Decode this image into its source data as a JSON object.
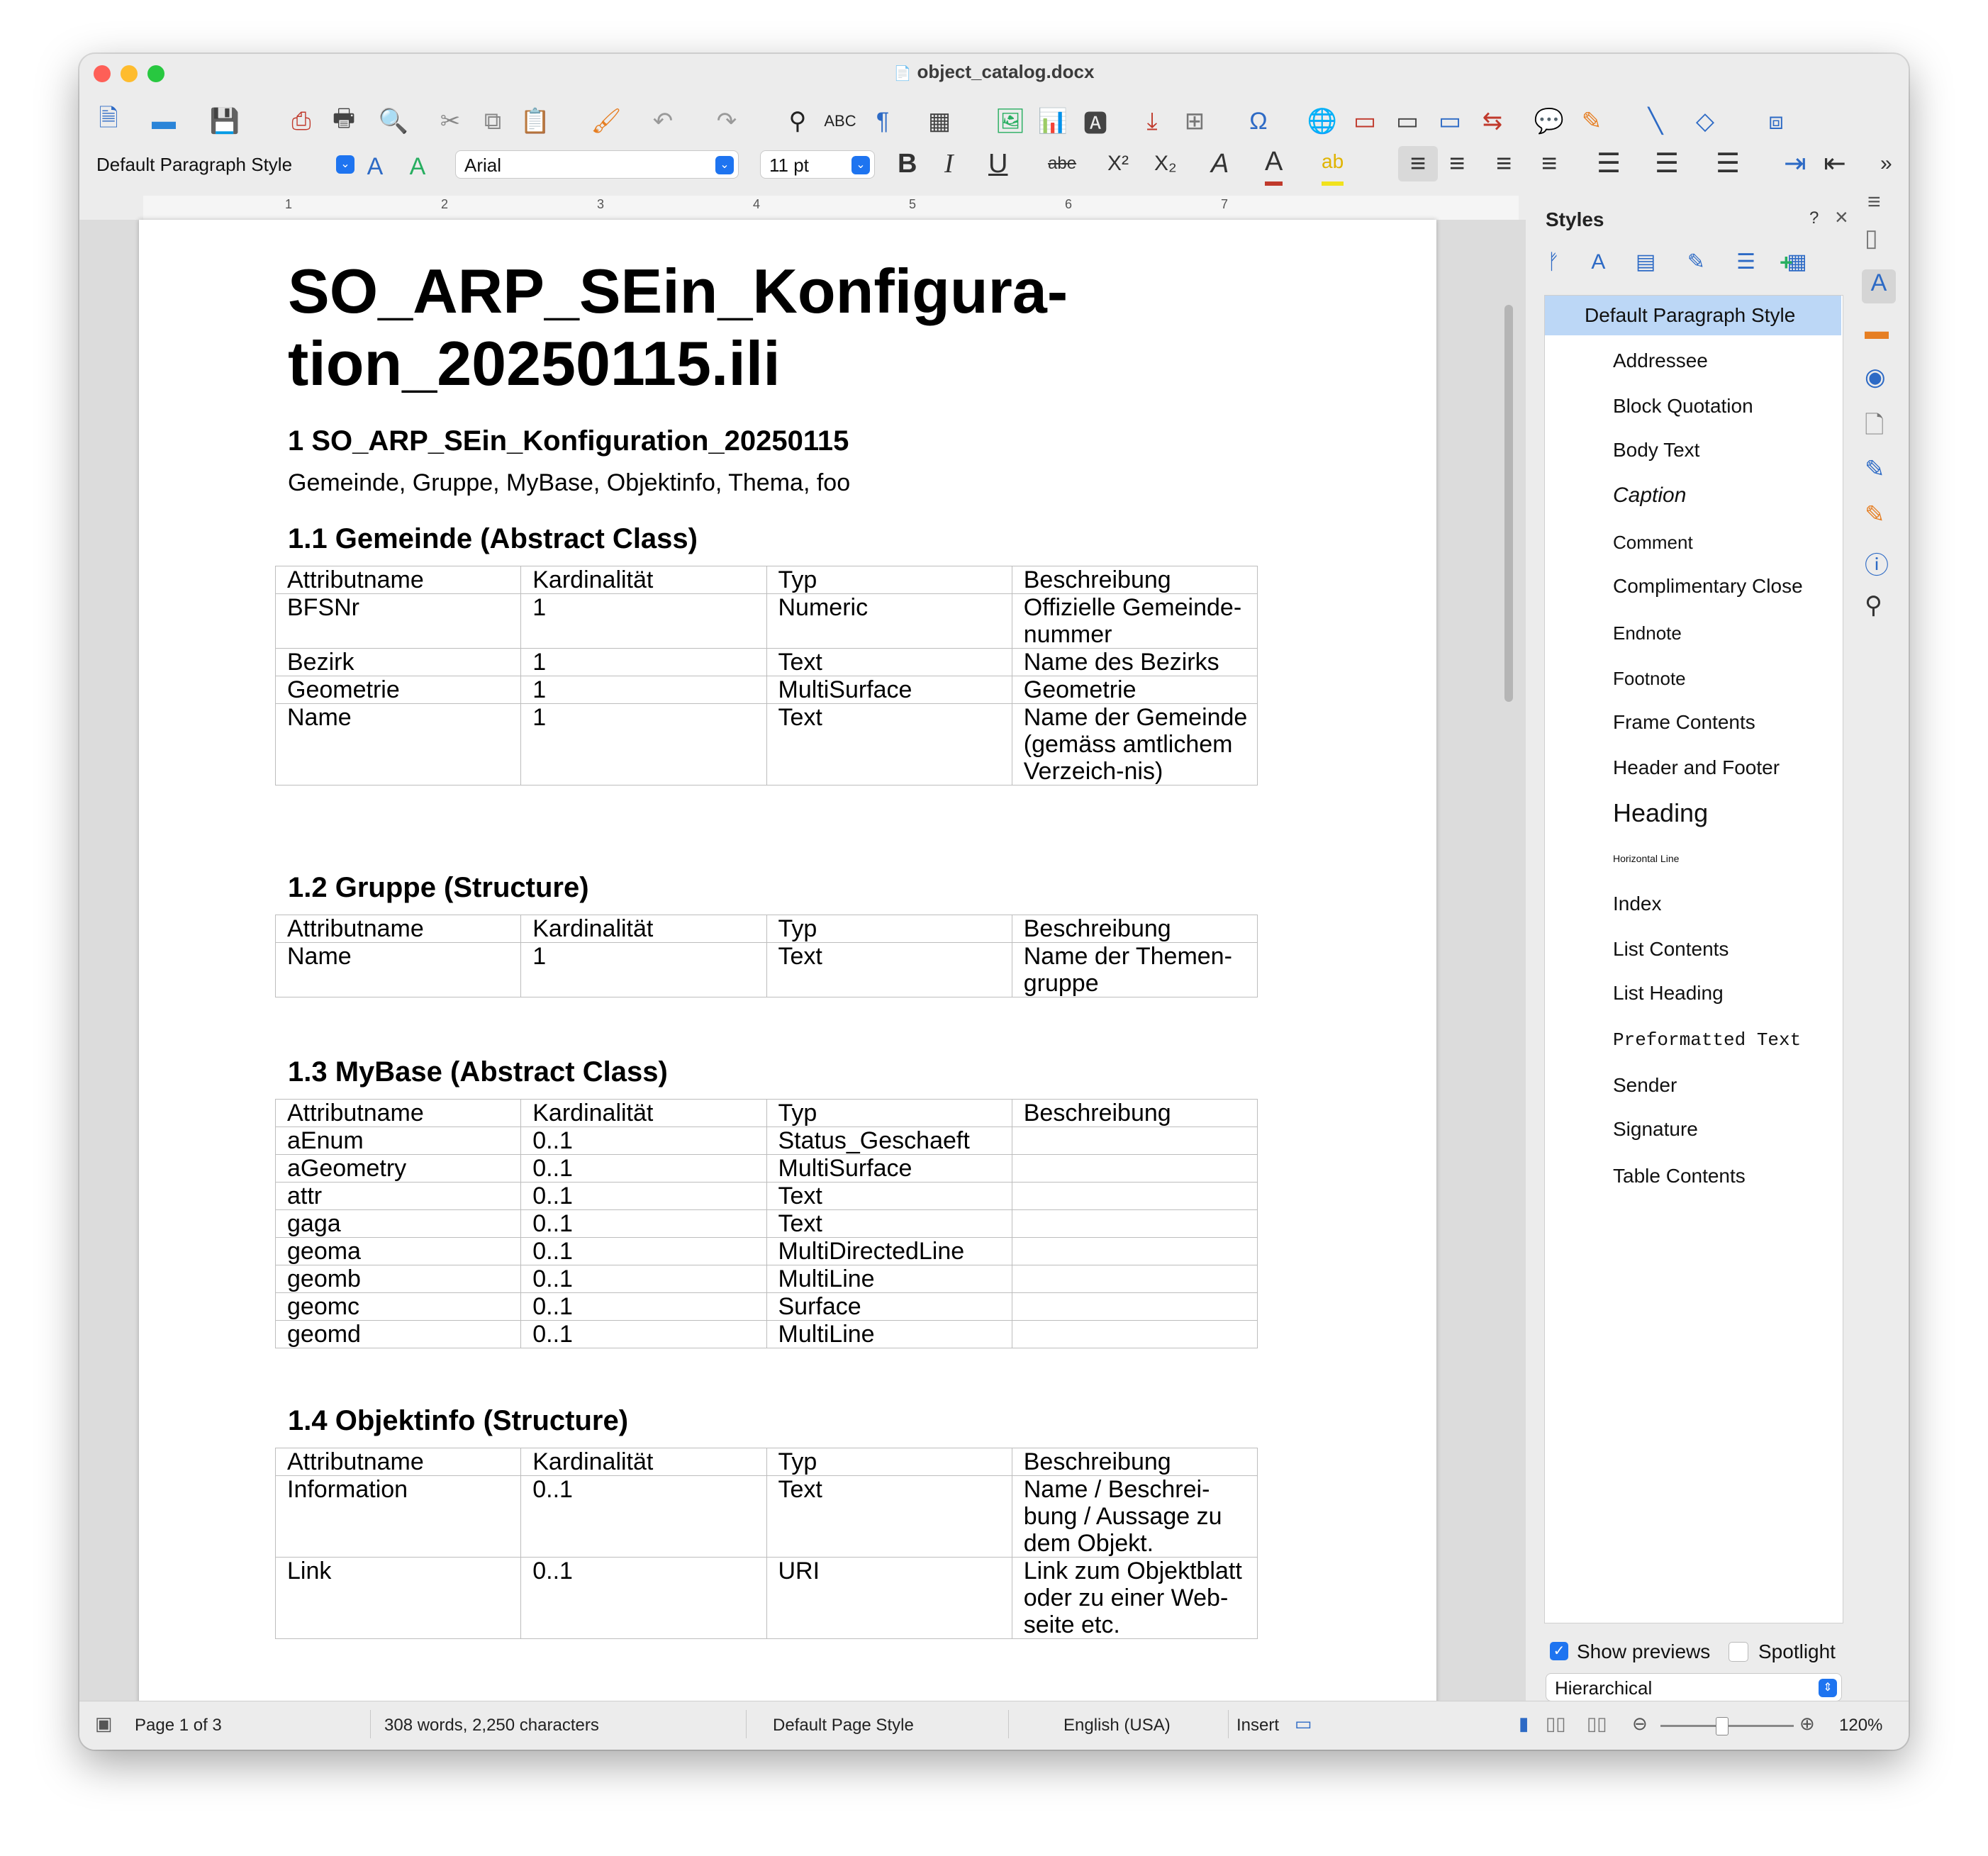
{
  "window": {
    "title": "object_catalog.docx"
  },
  "formatting": {
    "paragraph_style": "Default Paragraph Style",
    "font_name": "Arial",
    "font_size": "11 pt"
  },
  "document": {
    "title_line1": "SO_ARP_SEin_Konfigura-",
    "title_line2": "tion_20250115.ili",
    "heading1": "1  SO_ARP_SEin_Konfiguration_20250115",
    "topics": "Gemeinde, Gruppe, MyBase, Objektinfo, Thema, foo",
    "sections": [
      {
        "heading": "1.1  Gemeinde (Abstract Class)",
        "header": [
          "Attributname",
          "Kardinalität",
          "Typ",
          "Beschreibung"
        ],
        "rows": [
          [
            "BFSNr",
            "1",
            "Numeric",
            "Offizielle Gemeinde-nummer"
          ],
          [
            "Bezirk",
            "1",
            "Text",
            "Name des Bezirks"
          ],
          [
            "Geometrie",
            "1",
            "MultiSurface",
            "Geometrie"
          ],
          [
            "Name",
            "1",
            "Text",
            "Name der Gemeinde (gemäss amtlichem Verzeich-nis)"
          ]
        ]
      },
      {
        "heading": "1.2  Gruppe (Structure)",
        "header": [
          "Attributname",
          "Kardinalität",
          "Typ",
          "Beschreibung"
        ],
        "rows": [
          [
            "Name",
            "1",
            "Text",
            "Name der Themen-gruppe"
          ]
        ]
      },
      {
        "heading": "1.3  MyBase (Abstract Class)",
        "header": [
          "Attributname",
          "Kardinalität",
          "Typ",
          "Beschreibung"
        ],
        "rows": [
          [
            "aEnum",
            "0..1",
            "Status_Geschaeft",
            ""
          ],
          [
            "aGeometry",
            "0..1",
            "MultiSurface",
            ""
          ],
          [
            "attr",
            "0..1",
            "Text",
            ""
          ],
          [
            "gaga",
            "0..1",
            "Text",
            ""
          ],
          [
            "geoma",
            "0..1",
            "MultiDirectedLine",
            ""
          ],
          [
            "geomb",
            "0..1",
            "MultiLine",
            ""
          ],
          [
            "geomc",
            "0..1",
            "Surface",
            ""
          ],
          [
            "geomd",
            "0..1",
            "MultiLine",
            ""
          ]
        ]
      },
      {
        "heading": "1.4  Objektinfo (Structure)",
        "header": [
          "Attributname",
          "Kardinalität",
          "Typ",
          "Beschreibung"
        ],
        "rows": [
          [
            "Information",
            "0..1",
            "Text",
            "Name / Beschrei-bung / Aussage zu dem Objekt."
          ],
          [
            "Link",
            "0..1",
            "URI",
            "Link zum Objektblatt oder zu einer Web-seite etc."
          ]
        ]
      }
    ]
  },
  "sidebar": {
    "title": "Styles",
    "help": "?",
    "close": "×",
    "styles": [
      "Default Paragraph Style",
      "Addressee",
      "Block Quotation",
      "Body Text",
      "Caption",
      "Comment",
      "Complimentary Close",
      "Endnote",
      "Footnote",
      "Frame Contents",
      "Header and Footer",
      "Heading",
      "Horizontal Line",
      "Index",
      "List Contents",
      "List Heading",
      "Preformatted Text",
      "Sender",
      "Signature",
      "Table Contents"
    ],
    "selected_style": "Default Paragraph Style",
    "show_previews_label": "Show previews",
    "show_previews_checked": true,
    "spotlight_label": "Spotlight",
    "spotlight_checked": false,
    "filter": "Hierarchical"
  },
  "statusbar": {
    "page": "Page 1 of 3",
    "counts": "308 words, 2,250 characters",
    "page_style": "Default Page Style",
    "language": "English (USA)",
    "mode": "Insert",
    "zoom": "120%"
  },
  "ruler_numbers": [
    "1",
    "2",
    "3",
    "4",
    "5",
    "6",
    "7"
  ],
  "colors": {
    "accent": "#1e74f0",
    "selection": "#bcd7f6",
    "spell": "#e03030"
  }
}
